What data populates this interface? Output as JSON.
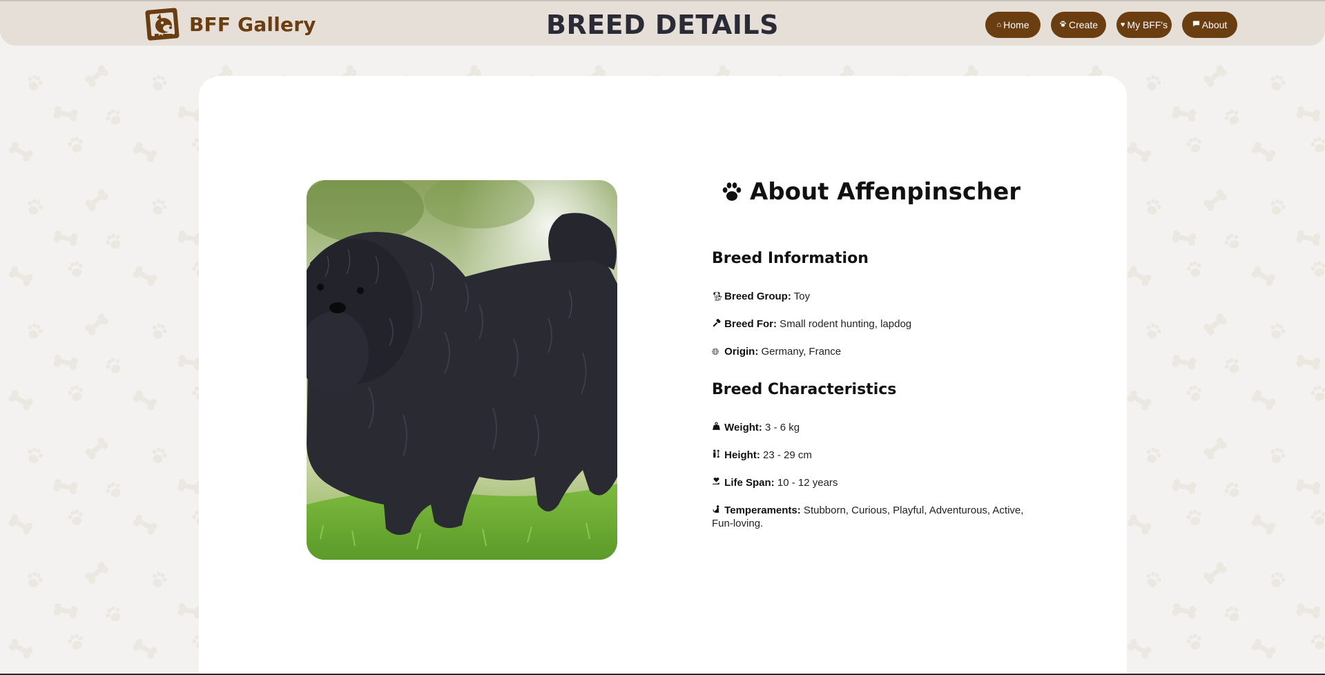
{
  "header": {
    "brand_name": "BFF Gallery",
    "page_title": "BREED DETAILS",
    "nav": [
      {
        "label": "Home",
        "icon": "home-icon"
      },
      {
        "label": "Create",
        "icon": "paw-icon"
      },
      {
        "label": "My BFF's",
        "icon": "heart-icon"
      },
      {
        "label": "About",
        "icon": "chat-icon"
      }
    ]
  },
  "breed": {
    "heading": "About Affenpinscher",
    "info_heading": "Breed Information",
    "info": [
      {
        "icon": "dog-icon",
        "label": "Breed Group:",
        "value": " Toy"
      },
      {
        "icon": "bone-icon",
        "label": "Breed For:",
        "value": " Small rodent hunting, lapdog"
      },
      {
        "icon": "globe-icon",
        "label": "Origin:",
        "value": " Germany, France"
      }
    ],
    "characteristics_heading": "Breed Characteristics",
    "characteristics": [
      {
        "icon": "weight-icon",
        "label": "Weight:",
        "value": " 3 - 6 kg"
      },
      {
        "icon": "height-icon",
        "label": "Height:",
        "value": " 23 - 29 cm"
      },
      {
        "icon": "heart-hand-icon",
        "label": "Life Span:",
        "value": " 10 - 12 years"
      },
      {
        "icon": "dog-sit-icon",
        "label": "Temperaments:",
        "value": " Stubborn, Curious, Playful, Adventurous, Active, Fun-loving."
      }
    ]
  },
  "colors": {
    "brand": "#6b3e12",
    "header_bg": "#e6dfd7",
    "page_bg": "#f3f2f0",
    "card_bg": "#ffffff"
  }
}
